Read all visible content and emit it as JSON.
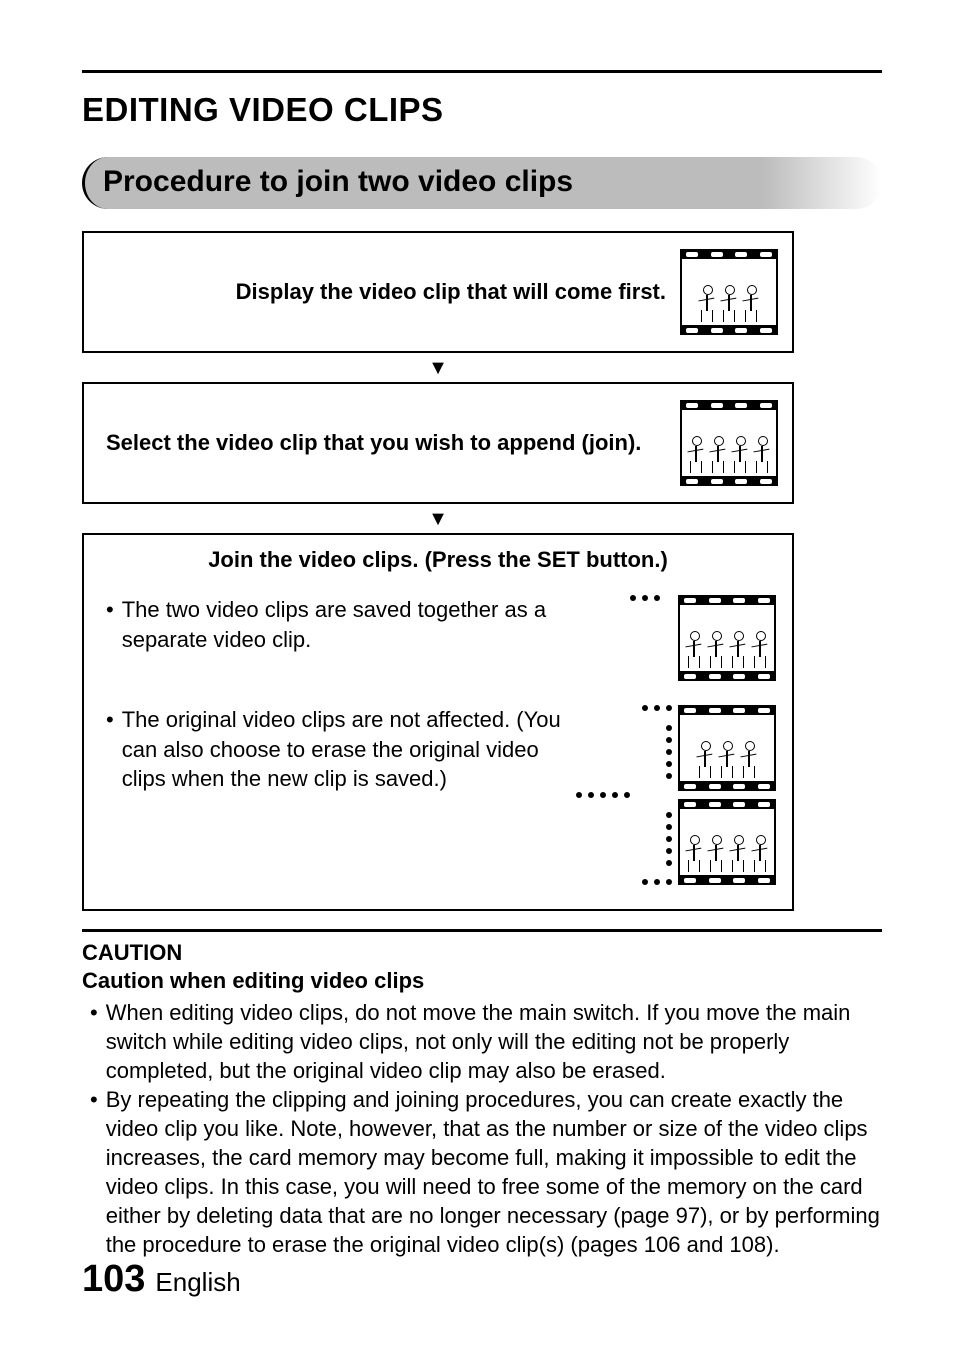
{
  "page_title": "EDITING VIDEO CLIPS",
  "section_title": "Procedure to join two video clips",
  "step1": "Display the video clip that will come first.",
  "step2": "Select the video clip that you wish to append (join).",
  "step3_title": "Join the video clips. (Press the SET button.)",
  "step3_bullet1": "The two video clips are saved together as a separate video clip.",
  "step3_bullet2": "The original video clips are not affected. (You can also choose to erase the original video clips when the new clip is saved.)",
  "caution_heading": "CAUTION",
  "caution_subheading": "Caution when editing video clips",
  "caution_item1": "When editing video clips, do not move the main switch. If you move the main switch while editing video clips, not only will the editing not be properly completed, but the original video clip may also be erased.",
  "caution_item2": "By repeating the clipping and joining procedures, you can create exactly the video clip you like. Note, however, that as the number or size of the video clips increases, the card memory may become full, making it impossible to edit the video clips. In this case, you will need to free some of the memory on the card either by deleting data that are no longer necessary (page 97), or by performing the procedure to erase the original video clip(s) (pages 106 and 108).",
  "page_number": "103",
  "page_language": "English"
}
